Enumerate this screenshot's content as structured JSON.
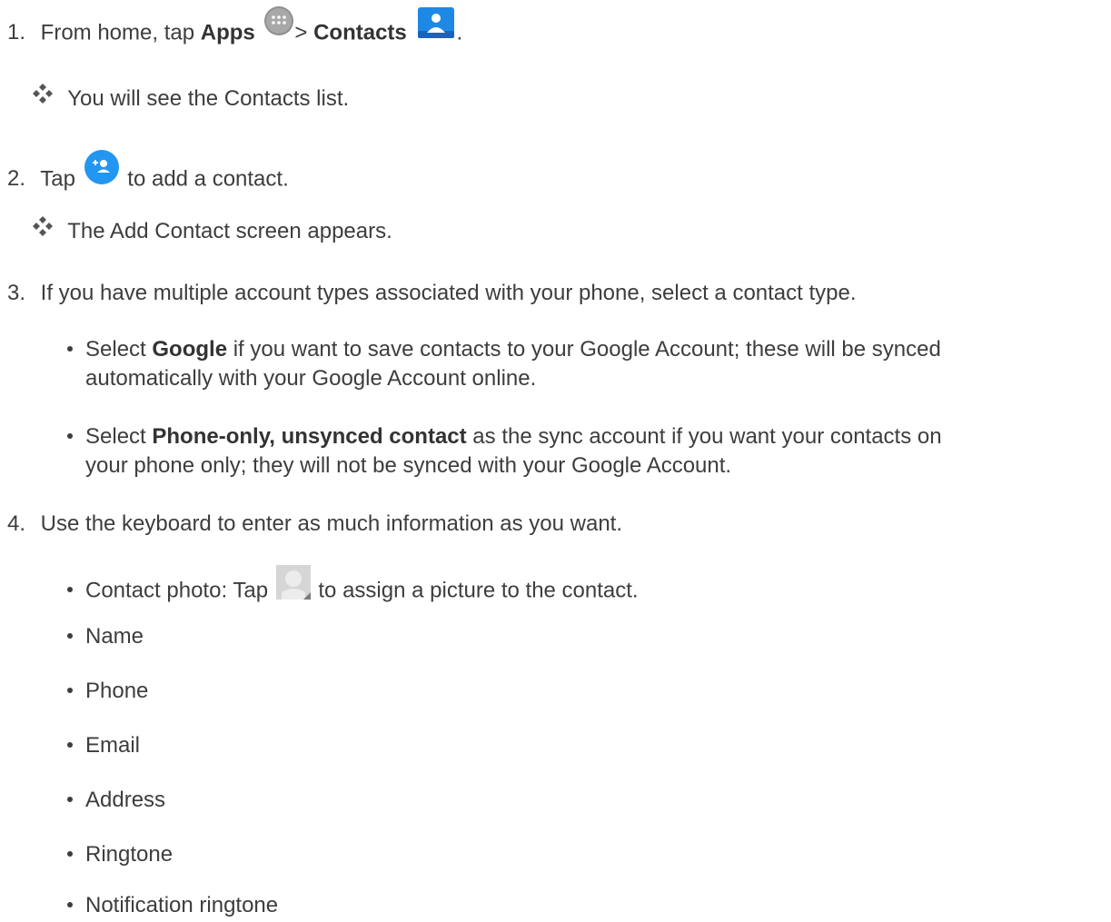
{
  "steps": [
    {
      "num": "1.",
      "pre": "From home, tap ",
      "apps": "Apps",
      "sep": "> ",
      "contacts": "Contacts",
      "post": ".",
      "icons": [
        "apps-icon",
        "contacts-icon"
      ]
    },
    {
      "num": "2.",
      "pre": "Tap",
      "post": "to add a contact.",
      "icons": [
        "add-contact-icon"
      ]
    },
    {
      "num": "3.",
      "text": "If you have multiple account types associated with your phone, select a contact type."
    },
    {
      "num": "4.",
      "text": "Use the keyboard to enter as much information as you want."
    }
  ],
  "results": {
    "step1": "You will see the Contacts list.",
    "step2": "The Add Contact screen appears."
  },
  "step3_bullets": [
    {
      "pre": "Select ",
      "bold": "Google",
      "line1": " if you want to save contacts to your Google Account; these will be synced",
      "line2": "automatically with your Google Account online."
    },
    {
      "pre": "Select ",
      "bold": "Phone-only, unsynced contact",
      "line1": " as the sync account if you want your contacts on",
      "line2": "your phone only; they will not be synced with your Google Account."
    }
  ],
  "step4_bullets": {
    "photo_pre": "Contact photo: Tap",
    "photo_post": "to assign a picture to the contact.",
    "photo_icon": "contact-photo-icon",
    "fields": [
      "Name",
      "Phone",
      "Email",
      "Address",
      "Ringtone",
      "Notification ringtone"
    ]
  },
  "colors": {
    "text": "#3d3d3d",
    "icon_blue": "#2196f3",
    "icon_grey": "#cfcfcf",
    "diamond": "#555555"
  }
}
